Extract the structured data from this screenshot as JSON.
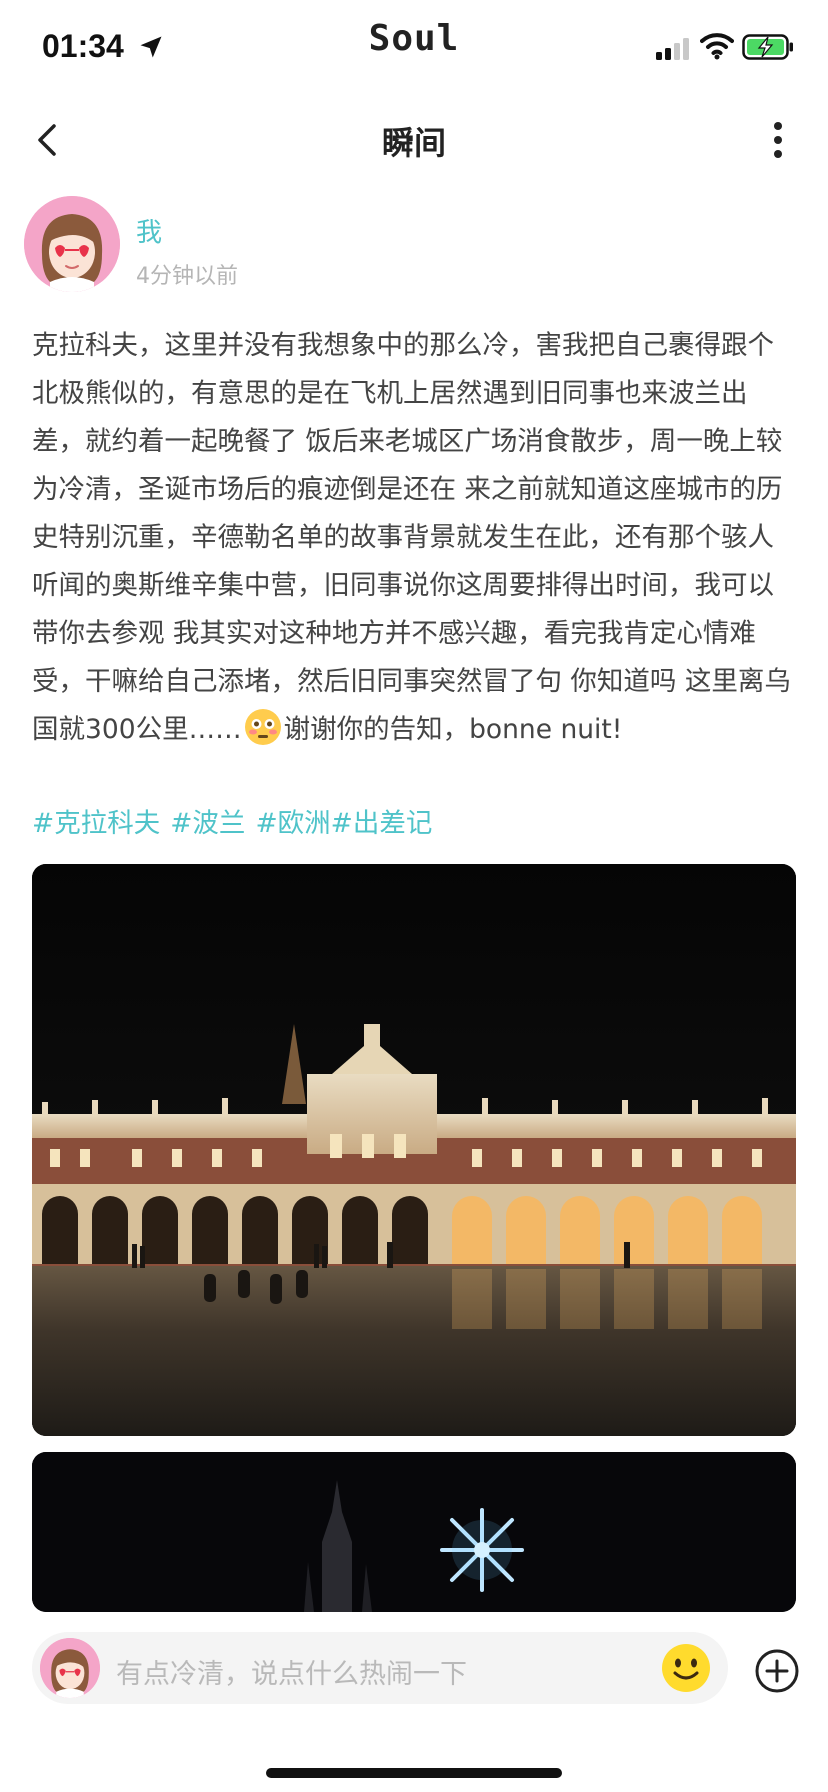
{
  "status_bar": {
    "time": "01:34",
    "app_brand": "Soul",
    "icons": [
      "location-arrow-icon",
      "signal-icon",
      "wifi-icon",
      "battery-charging-icon"
    ],
    "battery_color": "#4cd964"
  },
  "nav": {
    "title": "瞬间",
    "back_icon": "chevron-left-icon",
    "more_icon": "more-vertical-icon"
  },
  "post": {
    "author": "我",
    "time_ago": "4分钟以前",
    "text_before_emoji": "克拉科夫，这里并没有我想象中的那么冷，害我把自己裹得跟个北极熊似的，有意思的是在飞机上居然遇到旧同事也来波兰出差，就约着一起晚餐了 饭后来老城区广场消食散步，周一晚上较为冷清，圣诞市场后的痕迹倒是还在 来之前就知道这座城市的历史特别沉重，辛德勒名单的故事背景就发生在此，还有那个骇人听闻的奥斯维辛集中营，旧同事说你这周要排得出时间，我可以带你去参观 我其实对这种地方并不感兴趣，看完我肯定心情难受，干嘛给自己添堵，然后旧同事突然冒了句 你知道吗 这里离乌国就300公里……",
    "emoji": "flushed-face-emoji",
    "text_after_emoji": "谢谢你的告知，bonne nuit!",
    "tags": [
      "#克拉科夫",
      "#波兰",
      "#欧洲",
      "#出差记"
    ],
    "photos": [
      "krakow-cloth-hall-night-photo",
      "church-spire-christmas-star-photo"
    ]
  },
  "comment_bar": {
    "placeholder": "有点冷清，说点什么热闹一下",
    "emoji_icon": "smiley-icon",
    "add_icon": "plus-circle-icon"
  },
  "colors": {
    "accent": "#4fc3c9",
    "avatar_bg": "#f4a5c8",
    "muted_text": "#b5b5b5"
  }
}
